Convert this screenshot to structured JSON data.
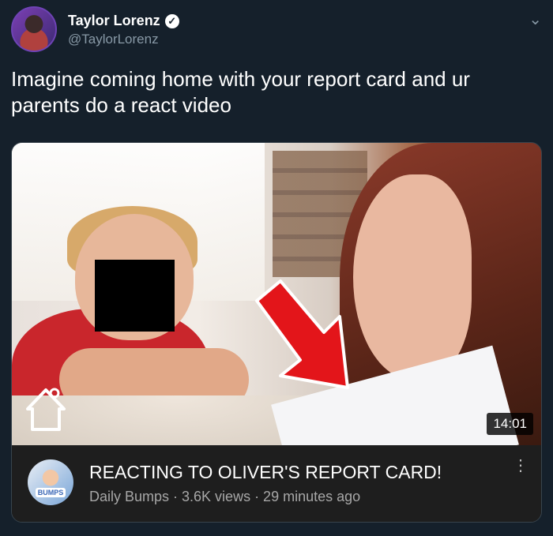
{
  "author": {
    "name": "Taylor Lorenz",
    "handle": "@TaylorLorenz",
    "verified_icon": "verified-badge-icon",
    "verified_glyph": "✓"
  },
  "menu_glyph": "⌄",
  "tweet": {
    "text": "Imagine coming home with your report card and ur parents do a react video"
  },
  "video": {
    "duration": "14:01",
    "title": "REACTING TO OLIVER'S REPORT CARD!",
    "channel": "Daily Bumps",
    "views": "3.6K views",
    "age": "29 minutes ago",
    "meta": "Daily Bumps · 3.6K views · 29 minutes ago",
    "channel_avatar_text": "BUMPS",
    "more_glyph": "⋮"
  },
  "colors": {
    "background": "#15202b",
    "arrow": "#e3151a",
    "secondary_text": "#8899a6"
  }
}
